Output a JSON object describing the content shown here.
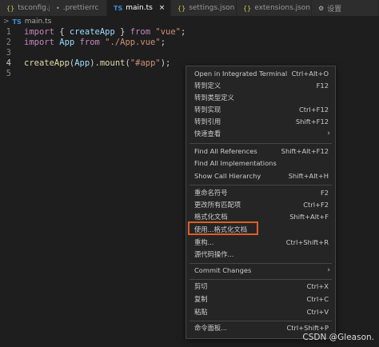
{
  "tabs": [
    {
      "icon": "json-icon",
      "glyph": "{}",
      "label": "tsconfig.json",
      "active": false
    },
    {
      "icon": "prettier-icon",
      "glyph": "•",
      "label": ".prettierrc",
      "active": false
    },
    {
      "icon": "typescript-icon",
      "glyph": "TS",
      "label": "main.ts",
      "active": true,
      "close": "×"
    },
    {
      "icon": "json-icon",
      "glyph": "{}",
      "label": "settings.json",
      "active": false
    },
    {
      "icon": "json-icon",
      "glyph": "{}",
      "label": "extensions.json",
      "active": false
    },
    {
      "icon": "gear-icon",
      "glyph": "⚙",
      "label": "设置",
      "active": false
    }
  ],
  "breadcrumb": {
    "sep": ">",
    "icon_glyph": "TS",
    "file": "main.ts"
  },
  "code": {
    "line_numbers": [
      "1",
      "2",
      "3",
      "4",
      "5"
    ],
    "line1": {
      "kw": "import",
      "p1": " { ",
      "id": "createApp",
      "p2": " } ",
      "kw2": "from",
      "str": " \"vue\"",
      "p3": ";"
    },
    "line2": {
      "kw": "import",
      "id": " App ",
      "kw2": "from",
      "str": " \"./App.vue\"",
      "p3": ";"
    },
    "line4": {
      "fn": "createApp",
      "p1": "(",
      "id": "App",
      "p2": ").",
      "fn2": "mount",
      "p3": "(",
      "str": "\"#app\"",
      "p4": ");"
    }
  },
  "menu": {
    "items": [
      {
        "label": "Open in Integrated Terminal",
        "key": "Ctrl+Alt+O"
      },
      {
        "label": "转到定义",
        "key": "F12"
      },
      {
        "label": "转到类型定义",
        "key": ""
      },
      {
        "label": "转到实现",
        "key": "Ctrl+F12"
      },
      {
        "label": "转到引用",
        "key": "Shift+F12"
      },
      {
        "label": "快速查看",
        "key": "",
        "arrow": "›"
      },
      {
        "label": "Find All References",
        "key": "Shift+Alt+F12"
      },
      {
        "label": "Find All Implementations",
        "key": ""
      },
      {
        "label": "Show Call Hierarchy",
        "key": "Shift+Alt+H"
      },
      {
        "label": "重命名符号",
        "key": "F2"
      },
      {
        "label": "更改所有匹配项",
        "key": "Ctrl+F2"
      },
      {
        "label": "格式化文档",
        "key": "Shift+Alt+F"
      },
      {
        "label": "使用...格式化文档",
        "key": ""
      },
      {
        "label": "重构...",
        "key": "Ctrl+Shift+R"
      },
      {
        "label": "源代码操作...",
        "key": ""
      },
      {
        "label": "Commit Changes",
        "key": "",
        "arrow": "›"
      },
      {
        "label": "剪切",
        "key": "Ctrl+X"
      },
      {
        "label": "复制",
        "key": "Ctrl+C"
      },
      {
        "label": "粘贴",
        "key": "Ctrl+V"
      },
      {
        "label": "命令面板...",
        "key": "Ctrl+Shift+P"
      }
    ]
  },
  "watermark": "CSDN @Gleason.",
  "colors": {
    "highlight_box": "#e05d26",
    "menu_bg": "#252526",
    "editor_bg": "#1e1e1e"
  }
}
